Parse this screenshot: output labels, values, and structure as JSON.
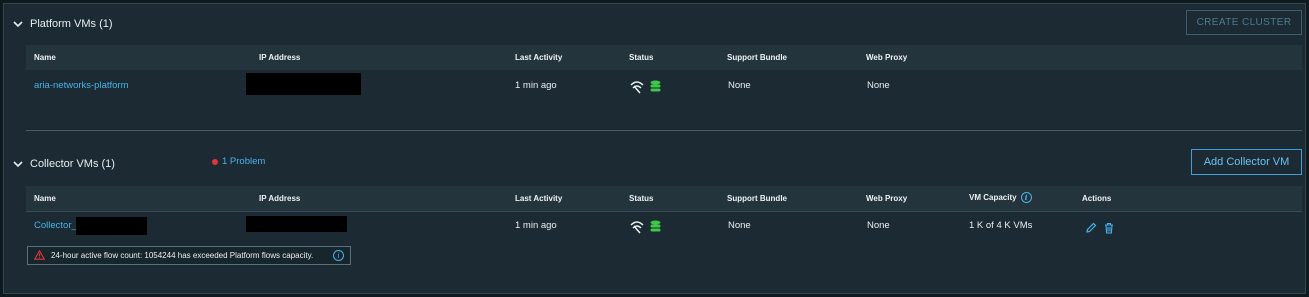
{
  "platform": {
    "title": "Platform VMs (1)",
    "create_cluster_label": "CREATE CLUSTER",
    "columns": [
      "Name",
      "IP Address",
      "Last Activity",
      "Status",
      "Support Bundle",
      "Web Proxy"
    ],
    "rows": [
      {
        "name": "aria-networks-platform",
        "last_activity": "1 min ago",
        "support_bundle": "None",
        "web_proxy": "None"
      }
    ]
  },
  "collector": {
    "title": "Collector VMs (1)",
    "problem_label": "1 Problem",
    "add_label": "Add Collector VM",
    "columns": [
      "Name",
      "IP Address",
      "Last Activity",
      "Status",
      "Support Bundle",
      "Web Proxy",
      "VM Capacity",
      "Actions"
    ],
    "rows": [
      {
        "name": "Collector_",
        "last_activity": "1 min ago",
        "support_bundle": "None",
        "web_proxy": "None",
        "vm_capacity": "1 K of 4 K VMs"
      }
    ],
    "alert_text": "24-hour active flow count: 1054244 has exceeded Platform flows capacity."
  },
  "icons": [
    "chevron-down-icon",
    "signal-icon",
    "database-icon",
    "info-icon",
    "edit-icon",
    "trash-icon",
    "warning-icon"
  ],
  "colors": {
    "background": "#1b2a33",
    "link": "#49b2ea",
    "status_green": "#3fc845",
    "problem_red": "#e3343d",
    "button_border": "#3f9fd6"
  }
}
